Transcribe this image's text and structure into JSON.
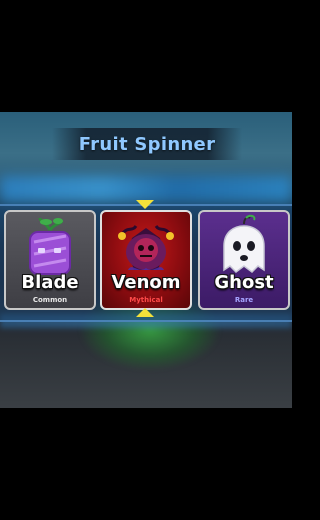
{
  "title": "Fruit Spinner",
  "cards": [
    {
      "name": "Blade",
      "rarity": "Common",
      "icon": "blade-fruit-icon"
    },
    {
      "name": "Venom",
      "rarity": "Mythical",
      "icon": "venom-fruit-icon"
    },
    {
      "name": "Ghost",
      "rarity": "Rare",
      "icon": "ghost-fruit-icon"
    }
  ],
  "selected_index": 1,
  "colors": {
    "title": "#8fc8ff",
    "pointer": "#f3e13a",
    "common": "#e8e8e8",
    "mythical": "#ff4a4a",
    "rare": "#a6a4ff"
  }
}
